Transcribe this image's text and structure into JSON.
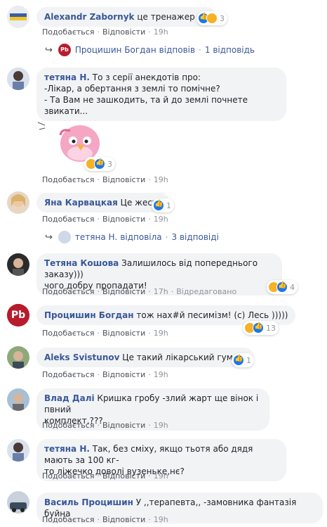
{
  "actions": {
    "like": "Подобається",
    "reply": "Відповісти",
    "sep": "·"
  },
  "comments": [
    {
      "author": "Alexandr Zabornyk",
      "text": "це тренажер",
      "emoji": "🙂",
      "time": "19h",
      "reactions": "3"
    },
    {
      "author": "тетяна Н.",
      "line1": "То з серії анекдотів про:",
      "line2": "-Лікар, а обертання з землі то помічне?",
      "line3": "- Та Вам не зашкодить, та й до землі почнете звикати...",
      "time": "19h",
      "reactions": "3"
    },
    {
      "author": "Яна Карвацкая",
      "text": "Це жесть",
      "time": "19h",
      "reactions": "1"
    },
    {
      "author": "Тетяна Кошова",
      "line1": "Залишилось від попереднього заказу)))",
      "line2": "чого добру пропадати!",
      "time": "17h",
      "edited": "Відредаговано",
      "reactions": "4"
    },
    {
      "author": "Процишин Богдан",
      "text": "тож нах#й песимізм! (с) Лесь )))))",
      "time": "19h",
      "reactions": "13"
    },
    {
      "author": "Aleks Svistunov",
      "text": "Це такий лікарський гумор.",
      "time": "19h",
      "reactions": "1"
    },
    {
      "author": "Влад Далі",
      "line1": "Кришка гробу -злий жарт ще вінок і пвний",
      "line2": "комплект.???",
      "time": "19h"
    },
    {
      "author": "тетяна Н.",
      "line1": "Так, без сміху, якщо тьотя або дядя мають за 100 кг-",
      "line2": "то ліжечко доволі вузеньке,нє?",
      "time": "19h"
    },
    {
      "author": "Василь Процишин",
      "text": "У ,,терапевта,, -замовника фантазія буйна",
      "time": "19h"
    }
  ],
  "replies": [
    {
      "author": "Процишин Богдан",
      "verb": "відповів",
      "count": "1 відповідь"
    },
    {
      "author": "тетяна Н.",
      "verb": "відповіла",
      "count": "3 відповіді"
    }
  ],
  "avatar_logo": "Pb",
  "colors": {
    "link": "#385898",
    "bubble": "#f2f3f5",
    "like": "#1877f2",
    "haha": "#f7b125",
    "meta": "#90949c"
  }
}
